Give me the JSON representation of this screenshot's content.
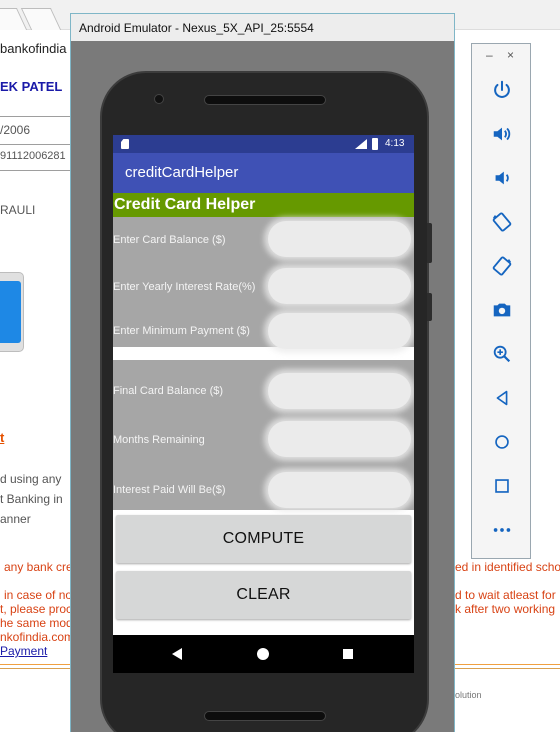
{
  "background_page": {
    "url_fragment": "bankofindia",
    "user_name_fragment": "EK PATEL",
    "date_fragment": "/2006",
    "account_fragment": "91112006281",
    "place_fragment": "RAULI",
    "orange_link_fragment": "t",
    "line1": "d using any",
    "line2": "t Banking in",
    "line3": "anner",
    "red_left": "any bank cre",
    "red_right": "ed in identified scho",
    "red2_left": "in case of no",
    "red2_right": "d to wait atleast for",
    "red3_left": "t, please proc",
    "red3_right": "k after two working",
    "red4_left": "he same mod",
    "red5_left": "nkofindia.com",
    "payment_link": "Payment",
    "solution_text": "olution"
  },
  "emulator": {
    "window_title": "Android Emulator - Nexus_5X_API_25:5554"
  },
  "status_bar": {
    "time": "4:13"
  },
  "app": {
    "app_title": "creditCardHelper",
    "header": "Credit Card Helper",
    "inputs": [
      {
        "label": "Enter Card Balance ($)",
        "value": ""
      },
      {
        "label": "Enter Yearly Interest Rate(%)",
        "value": ""
      },
      {
        "label": "Enter Minimum Payment ($)",
        "value": ""
      }
    ],
    "outputs": [
      {
        "label": "Final Card Balance ($)",
        "value": ""
      },
      {
        "label": "Months Remaining",
        "value": ""
      },
      {
        "label": "Interest Paid Will Be($)",
        "value": ""
      }
    ],
    "compute_label": "COMPUTE",
    "clear_label": "CLEAR"
  },
  "toolbar": {
    "minimize_label": "–",
    "close_label": "×",
    "icons": [
      "power-icon",
      "volume-up-icon",
      "volume-down-icon",
      "rotate-left-icon",
      "rotate-right-icon",
      "camera-icon",
      "zoom-icon",
      "back-icon",
      "home-icon",
      "overview-icon",
      "more-icon"
    ]
  },
  "colors": {
    "status_bar": "#2c3d91",
    "app_bar": "#3f51b5",
    "header_band": "#669900",
    "panel": "#a6a6a6",
    "button": "#d6d7d7",
    "toolbar_icon": "#1565c0"
  }
}
